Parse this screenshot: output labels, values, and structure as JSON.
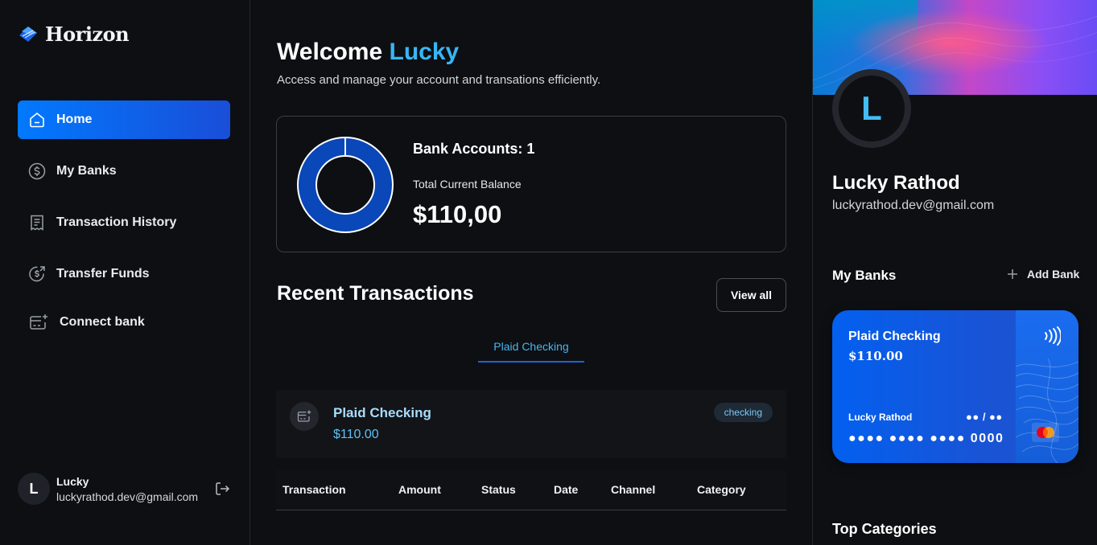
{
  "app": {
    "name": "Horizon"
  },
  "sidebar": {
    "items": [
      {
        "label": "Home",
        "icon": "home-icon",
        "active": true
      },
      {
        "label": "My Banks",
        "icon": "dollar-circle-icon",
        "active": false
      },
      {
        "label": "Transaction History",
        "icon": "receipt-icon",
        "active": false
      },
      {
        "label": "Transfer Funds",
        "icon": "money-send-icon",
        "active": false
      },
      {
        "label": "Connect bank",
        "icon": "card-add-icon",
        "active": false
      }
    ],
    "user": {
      "initial": "L",
      "name": "Lucky",
      "email": "luckyrathod.dev@gmail.com"
    }
  },
  "header": {
    "welcome": "Welcome",
    "user_first_name": "Lucky",
    "subtitle": "Access and manage your account and transations efficiently."
  },
  "balance": {
    "bank_accounts_label": "Bank Accounts: 1",
    "total_label": "Total Current Balance",
    "total_value": "$110,00",
    "donut_fraction": 1.0
  },
  "transactions": {
    "title": "Recent Transactions",
    "view_all_label": "View all",
    "tabs": [
      "Plaid Checking"
    ],
    "account": {
      "name": "Plaid Checking",
      "amount": "$110.00",
      "badge": "checking"
    },
    "columns": [
      "Transaction",
      "Amount",
      "Status",
      "Date",
      "Channel",
      "Category"
    ]
  },
  "profile": {
    "initial": "L",
    "name": "Lucky Rathod",
    "email": "luckyrathod.dev@gmail.com"
  },
  "my_banks": {
    "title": "My Banks",
    "add_label": "Add Bank",
    "card": {
      "bank_name": "Plaid Checking",
      "balance": "$110.00",
      "holder": "Lucky Rathod",
      "expiry": "●● / ●●",
      "number": "●●●● ●●●● ●●●● 0000"
    }
  },
  "top_categories": {
    "title": "Top Categories"
  },
  "colors": {
    "accent": "#0179fe",
    "highlight": "#38b6f5",
    "donut": "#0a47b8",
    "background": "#0d0f12"
  }
}
